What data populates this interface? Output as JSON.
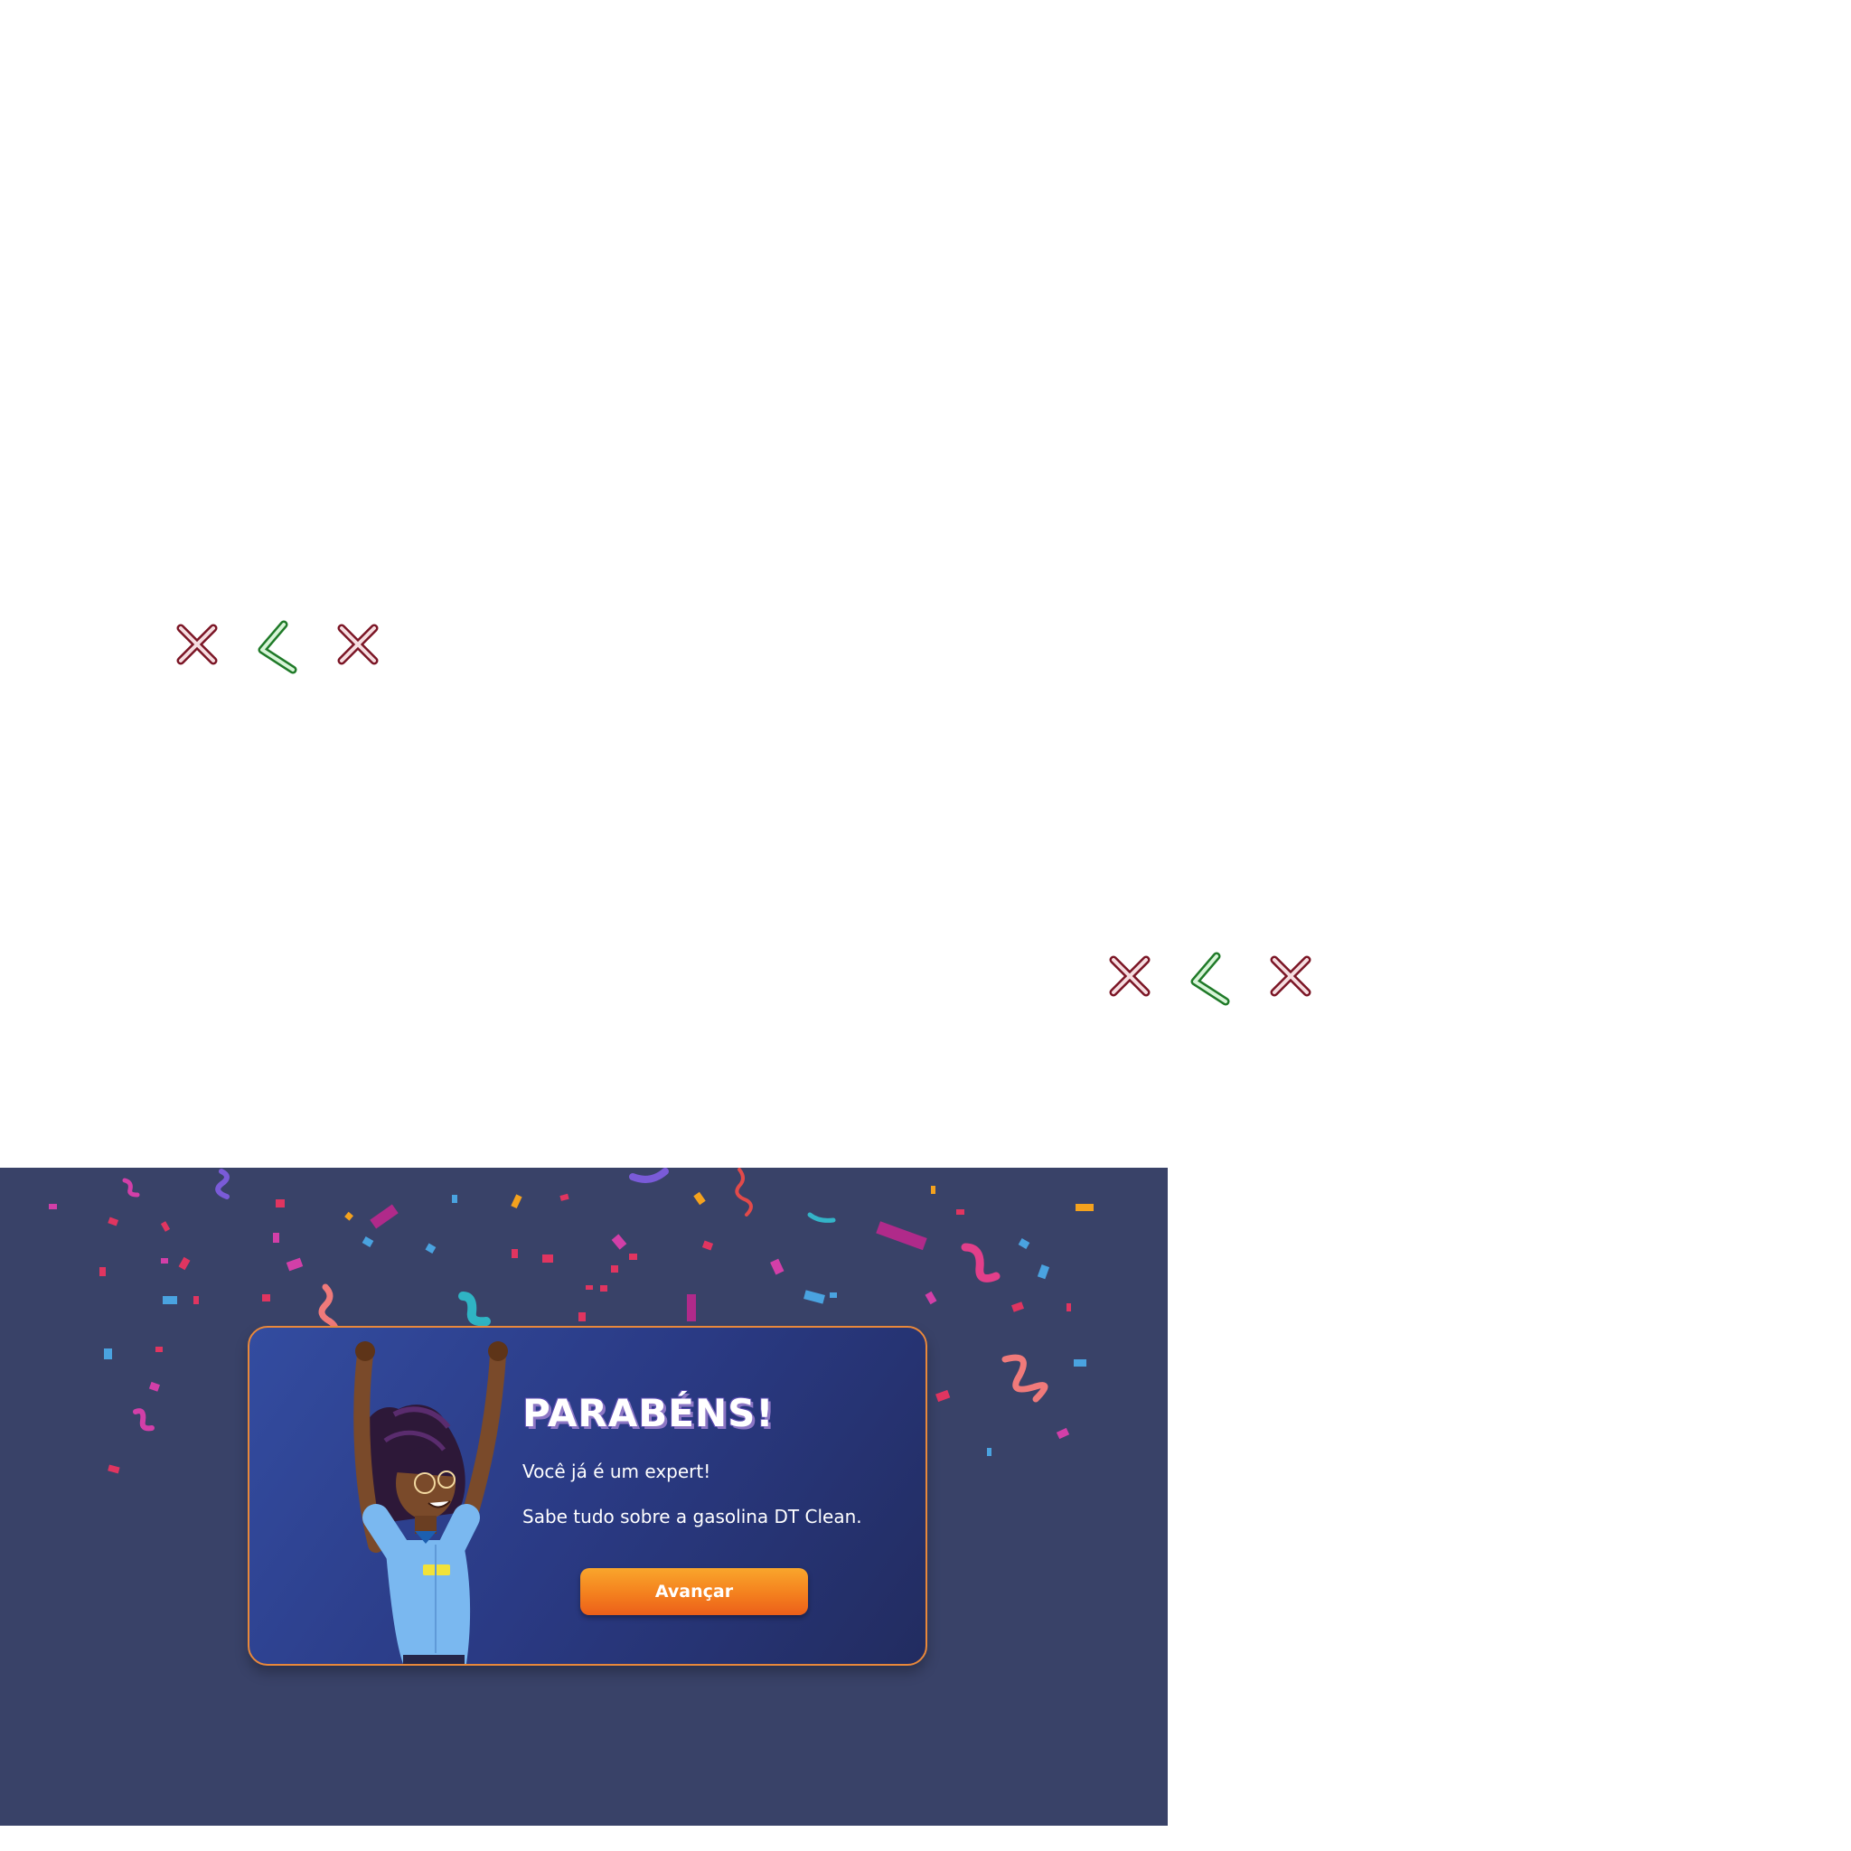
{
  "answer_marks": [
    {
      "group": "top-left",
      "marks": [
        "cross-icon",
        "check-icon",
        "cross-icon"
      ]
    },
    {
      "group": "middle-right",
      "marks": [
        "cross-icon",
        "check-icon",
        "cross-icon"
      ]
    }
  ],
  "colors": {
    "scene_background": "#394268",
    "card_border": "#e9883a",
    "button_orange": "#f4801e",
    "cross_red": "#a32035",
    "check_green": "#2fa83a"
  },
  "modal": {
    "title": "PARABÉNS!",
    "line1": "Você já é um expert!",
    "line2": "Sabe tudo sobre a gasolina DT Clean.",
    "button_label": "Avançar"
  }
}
